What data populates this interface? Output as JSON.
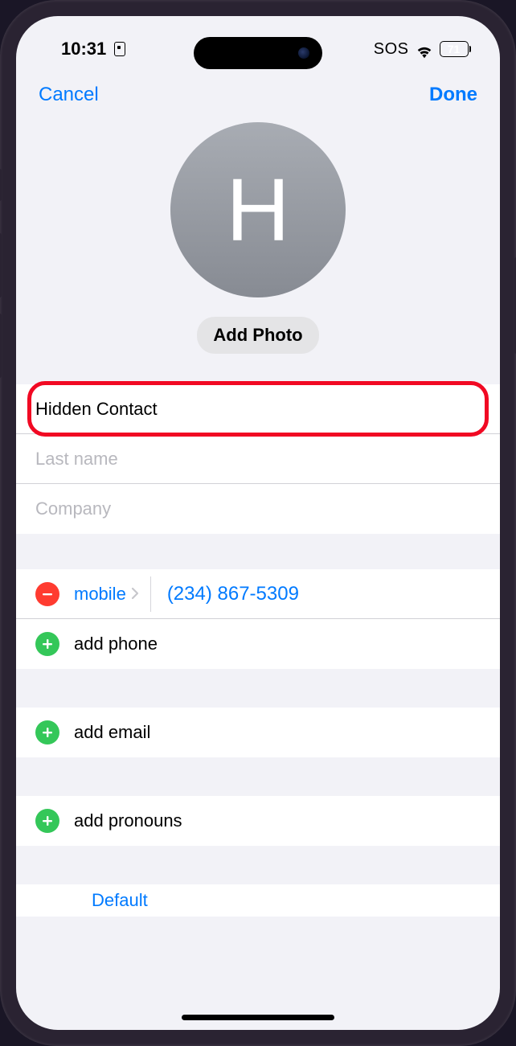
{
  "status": {
    "time": "10:31",
    "sos": "SOS",
    "battery": "71"
  },
  "nav": {
    "cancel": "Cancel",
    "done": "Done"
  },
  "avatar": {
    "initial": "H",
    "addPhoto": "Add Photo"
  },
  "fields": {
    "firstName": "Hidden Contact",
    "lastNamePlaceholder": "Last name",
    "companyPlaceholder": "Company"
  },
  "phones": {
    "label": "mobile",
    "number": "(234) 867-5309",
    "add": "add phone"
  },
  "email": {
    "add": "add email"
  },
  "pronouns": {
    "add": "add pronouns"
  },
  "tone": {
    "default": "Default"
  }
}
